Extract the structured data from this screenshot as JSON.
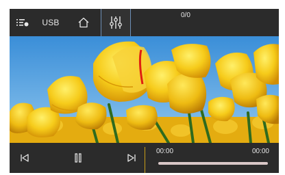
{
  "topbar": {
    "list_icon": "playlist-icon",
    "source_label": "USB",
    "home_icon": "home-icon",
    "eq_icon": "equalizer-icon",
    "counter": "0/0"
  },
  "photo": {
    "subject": "tulip-field-photo"
  },
  "controls": {
    "prev_icon": "skip-previous-icon",
    "pause_icon": "pause-icon",
    "next_icon": "skip-next-icon"
  },
  "progress": {
    "elapsed": "00:00",
    "duration": "00:00",
    "fraction": 0
  },
  "colors": {
    "bar_background": "#2b2b2b",
    "accent": "#c89e18",
    "highlight_border": "#6d8fb6",
    "text": "#e8e8e8"
  }
}
